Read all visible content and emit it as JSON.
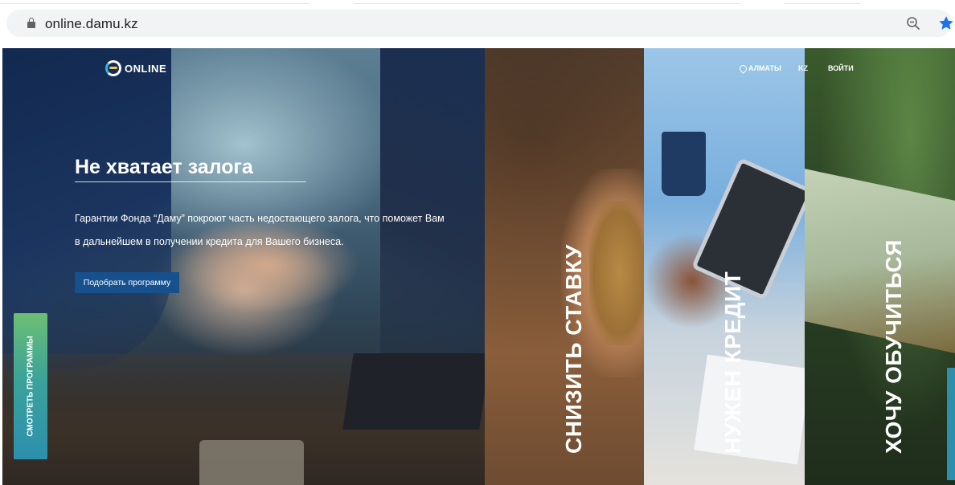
{
  "browser": {
    "url": "online.damu.kz"
  },
  "site": {
    "logo_text": "ONLINE",
    "nav": {
      "city": "АЛМАТЫ",
      "lang": "KZ",
      "login": "ВОЙТИ"
    },
    "hero": {
      "title": "Не хватает залога",
      "subtitle": "Гарантии Фонда “Даму” покроют часть недостающего залога, что поможет Вам в дальнейшем в получении кредита для Вашего бизнеса.",
      "cta_label": "Подобрать программу"
    },
    "side_tab_label": "СМОТРЕТЬ ПРОГРАММЫ",
    "panels": [
      {
        "label": "СНИЗИТЬ СТАВКУ"
      },
      {
        "label": "НУЖЕН КРЕДИТ"
      },
      {
        "label": "ХОЧУ ОБУЧИТЬСЯ"
      }
    ]
  },
  "colors": {
    "cta": "#16518e",
    "star": "#1a73e8",
    "side_tab_top": "#6dbf73",
    "side_tab_bottom": "#2d8fae"
  },
  "icons": [
    "lock-icon",
    "zoom-out-icon",
    "bookmark-star-icon",
    "location-pin-icon",
    "logo-icon"
  ]
}
